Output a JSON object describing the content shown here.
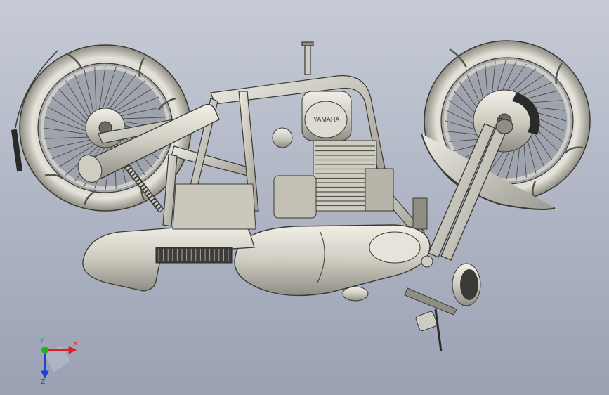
{
  "viewport": {
    "background_top": "#c6cbd6",
    "background_bottom": "#9aa1b3",
    "model_color": "#d8d6cc",
    "edge_color": "#3a3a34"
  },
  "model": {
    "icon": "motorcycle-cad-model",
    "tank_logo": "YAMAHA"
  },
  "triad": {
    "x_label": "X",
    "y_label": "Y",
    "z_label": "Z",
    "x_color": "#e02020",
    "y_color": "#20b020",
    "z_color": "#2040d0"
  }
}
